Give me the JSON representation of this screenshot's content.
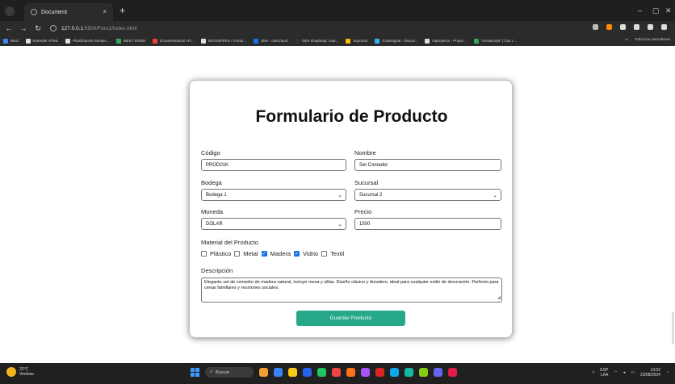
{
  "browser": {
    "tab_title": "Document",
    "tab_close": "×",
    "new_tab": "+",
    "url_host": "127.0.0.1",
    "url_path": ":5500/Foro1/index.html",
    "window_controls": {
      "minimize": "–",
      "maximize": "▢",
      "close": "✕"
    },
    "bookmarks": [
      {
        "label": "Bard",
        "color": "#4285f4"
      },
      {
        "label": "Entender HTML",
        "color": "#e0e0e0"
      },
      {
        "label": "Planificación Seman...",
        "color": "#e0e0e0"
      },
      {
        "label": "MEET DISEB",
        "color": "#34a853"
      },
      {
        "label": "Documentación HT...",
        "color": "#ea4335"
      },
      {
        "label": "DEVS4PERU c Fortur...",
        "color": "#e0e0e0"
      },
      {
        "label": "Skm - ownCloud",
        "color": "#1a73e8"
      },
      {
        "label": "DDA Roadmap: Lear...",
        "color": "#333333"
      },
      {
        "label": "Squoosh",
        "color": "#fbbc04"
      },
      {
        "label": "CodeSignal - Discov...",
        "color": "#29b6f6"
      },
      {
        "label": "miproyecto - Projec...",
        "color": "#e0e0e0"
      },
      {
        "label": "\"ecmascript\" | Can I...",
        "color": "#34a853"
      }
    ],
    "bookmarks_right": "Todos los marcadores"
  },
  "form": {
    "title": "Formulario de Producto",
    "codigo_label": "Código",
    "codigo_value": "PROD01K",
    "nombre_label": "Nombre",
    "nombre_value": "Set Comedor",
    "bodega_label": "Bodega",
    "bodega_value": "Bodega 1",
    "sucursal_label": "Sucursal",
    "sucursal_value": "Sucursal 2",
    "moneda_label": "Moneda",
    "moneda_value": "DÓLAR",
    "precio_label": "Precio",
    "precio_value": "1500",
    "material_label": "Material del Producto",
    "materials": [
      {
        "label": "Plástico",
        "checked": false
      },
      {
        "label": "Metal",
        "checked": false
      },
      {
        "label": "Madera",
        "checked": true
      },
      {
        "label": "Vidrio",
        "checked": true
      },
      {
        "label": "Textil",
        "checked": false
      }
    ],
    "descripcion_label": "Descripción",
    "descripcion_value": "Elegante set de comedor de madera natural, incluye mesa y sillas. Diseño clásico y duradero, ideal para cualquier estilo de decoración. Perfecto para cenas familiares y reuniones sociales.",
    "submit_label": "Guardar Producto",
    "accent": "#26a889"
  },
  "taskbar": {
    "weather_temp": "22°C",
    "weather_desc": "Ventoso",
    "search_label": "Buscar",
    "lang_top": "ESP",
    "lang_bottom": "LAA",
    "time": "13:03",
    "date": "23/08/2024"
  }
}
